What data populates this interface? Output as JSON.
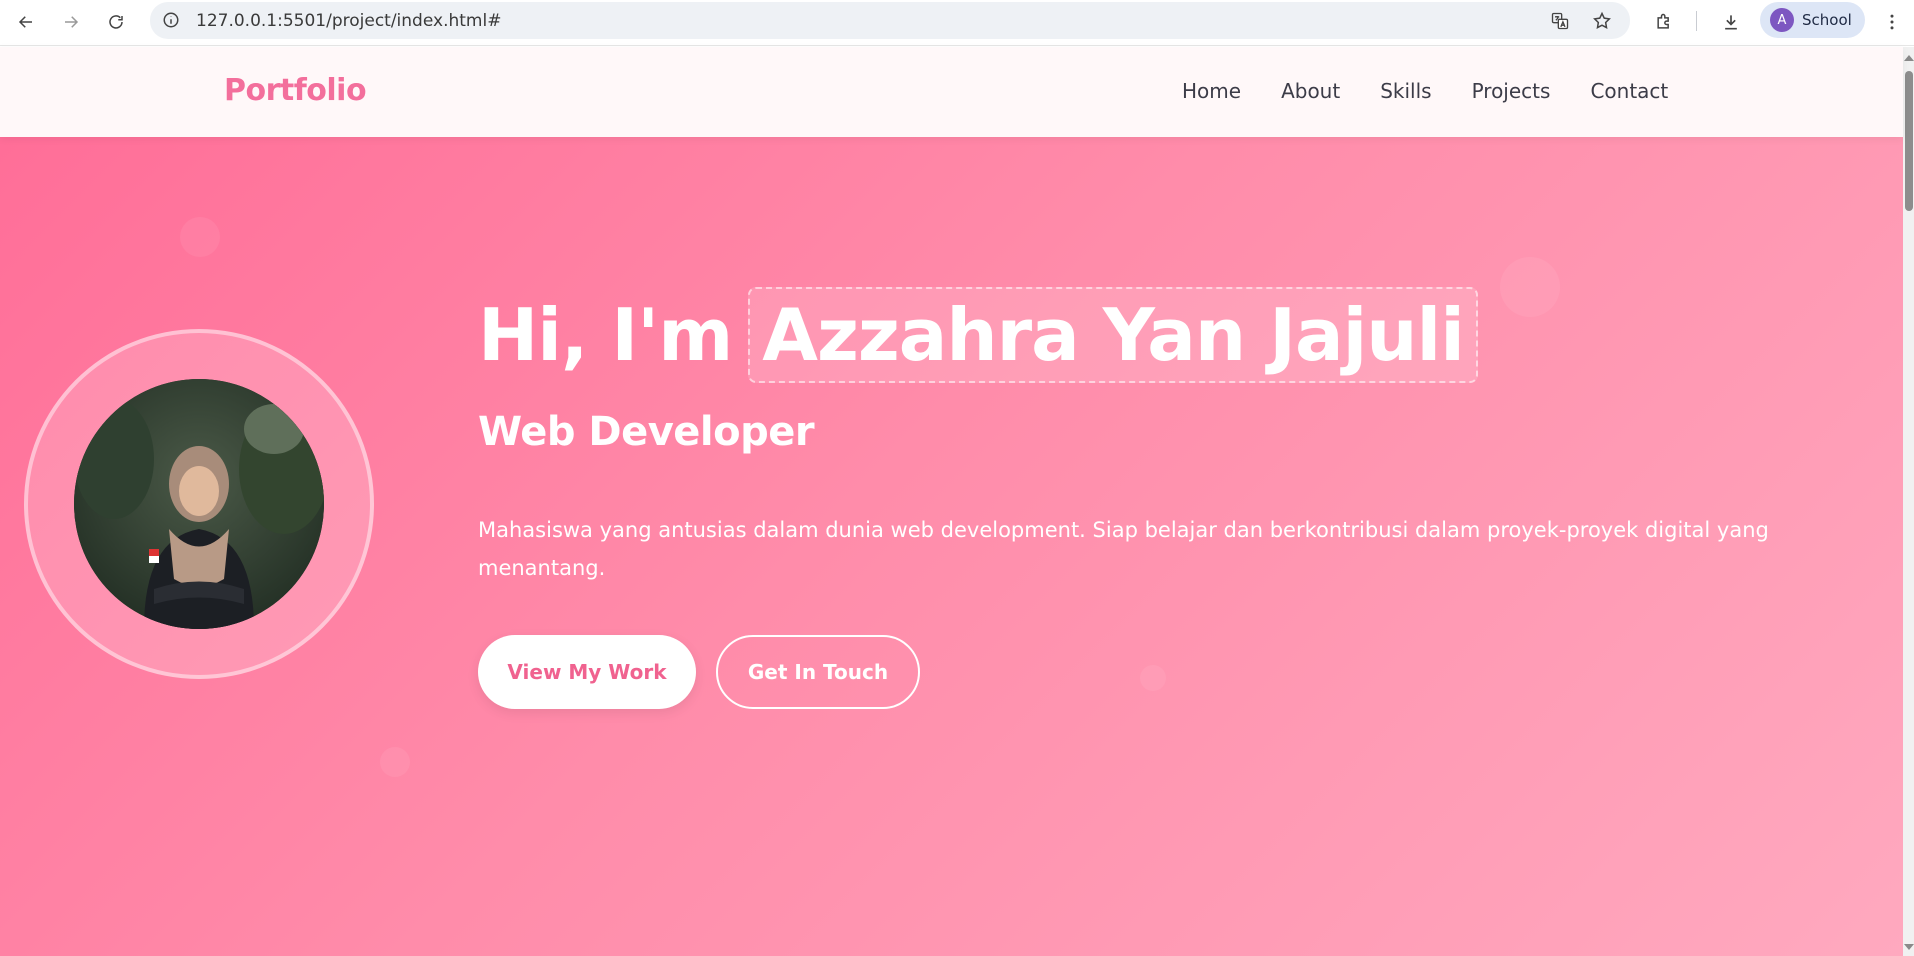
{
  "browser": {
    "url": "127.0.0.1:5501/project/index.html#",
    "profile_initial": "A",
    "profile_name": "School",
    "profile_color": "#7d57c1"
  },
  "header": {
    "logo": "Portfolio",
    "nav": [
      "Home",
      "About",
      "Skills",
      "Projects",
      "Contact"
    ]
  },
  "hero": {
    "greeting": "Hi, I'm",
    "name": "Azzahra Yan Jajuli",
    "role": "Web Developer",
    "description": "Mahasiswa yang antusias dalam dunia web development. Siap belajar dan berkontribusi dalam proyek-proyek digital yang menantang.",
    "primary_button": "View My Work",
    "secondary_button": "Get In Touch",
    "profile_photo_icon": "profile-photo"
  },
  "colors": {
    "accent": "#f36f9c",
    "hero_gradient_start": "#ff6e98",
    "hero_gradient_end": "#ffa9bf"
  }
}
